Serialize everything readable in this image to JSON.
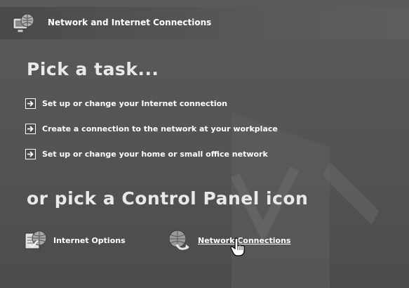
{
  "header": {
    "title": "Network and Internet Connections",
    "icon": "network-connections-icon"
  },
  "main": {
    "pick_task_heading": "Pick a task...",
    "tasks": [
      {
        "label": "Set up or change your Internet connection",
        "icon": "arrow-right-icon"
      },
      {
        "label": "Create a connection to the network at your workplace",
        "icon": "arrow-right-icon"
      },
      {
        "label": "Set up or change your home or small office network",
        "icon": "arrow-right-icon"
      }
    ],
    "control_panel_heading": "or pick a Control Panel icon",
    "control_panel_items": [
      {
        "label": "Internet Options",
        "icon": "internet-options-icon"
      },
      {
        "label": "Network Connections",
        "icon": "network-connections-globe-icon",
        "hovered": true
      }
    ]
  },
  "cursor": {
    "type": "hand-pointer-icon"
  }
}
